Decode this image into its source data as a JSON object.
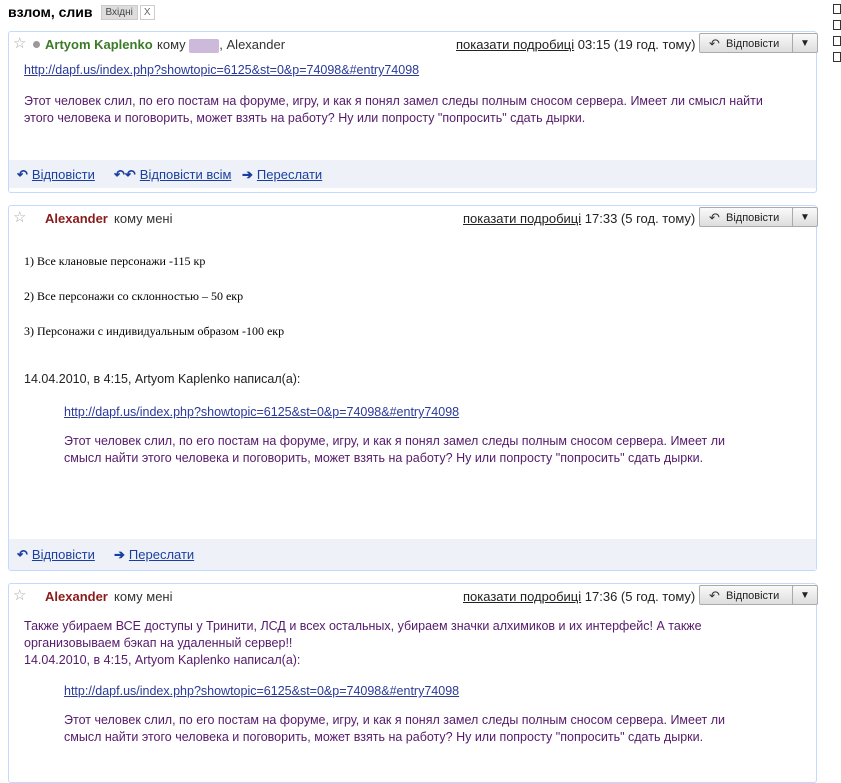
{
  "thread": {
    "subject": "взлом, слив",
    "label": "Вхідні",
    "label_close": "X"
  },
  "msg1": {
    "sender": "Artyom Kaplenko",
    "to_prefix": "кому",
    "to_rest": ", Alexander",
    "show_details": "показати подробиці",
    "time": "03:15 (19 год. тому)",
    "reply": "Відповісти",
    "more": "▼",
    "link": "http://dapf.us/index.php?showtopic=6125&st=0&p=74098&#entry74098",
    "text": "Этот человек слил, по его постам на форуме, игру, и как я понял замел следы полным сносом сервера. Имеет ли смысл найти этого человека и поговорить, может взять на работу? Ну или попросту \"попросить\" сдать дырки.",
    "footer_reply": "Відповісти",
    "footer_reply_all": "Відповісти всім",
    "footer_forward": "Переслати"
  },
  "msg2": {
    "sender": "Alexander",
    "to": "кому мені",
    "show_details": "показати подробиці",
    "time": "17:33 (5 год. тому)",
    "reply": "Відповісти",
    "more": "▼",
    "items": [
      "1)  Все клановые персонажи -115 кр",
      "2)  Все персонажи со склонностью – 50 екр",
      "3)  Персонажи с индивидуальным образом -100 екр"
    ],
    "quote_header": "14.04.2010, в 4:15, Artyom Kaplenko написал(а):",
    "quote_link": "http://dapf.us/index.php?showtopic=6125&st=0&p=74098&#entry74098",
    "quote_line1": "Этот человек слил, по его постам на форуме, игру, и как я понял замел следы полным сносом сервера. Имеет ли",
    "quote_line2": "смысл найти этого человека и поговорить, может взять на работу? Ну или попросту \"попросить\" сдать дырки.",
    "footer_reply": "Відповісти",
    "footer_forward": "Переслати"
  },
  "msg3": {
    "sender": "Alexander",
    "to": "кому мені",
    "show_details": "показати подробиці",
    "time": "17:36 (5 год. тому)",
    "reply": "Відповісти",
    "more": "▼",
    "text_line1": "Также убираем ВСЕ доступы у Тринити, ЛСД и всех остальных, убираем значки алхимиков и их интерфейс! А также",
    "text_line2": "организовываем бэкап на удаленный сервер!!",
    "quote_header": "14.04.2010, в 4:15, Artyom Kaplenko написал(а):",
    "quote_link": "http://dapf.us/index.php?showtopic=6125&st=0&p=74098&#entry74098",
    "quote_line1": "Этот человек слил, по его постам на форуме, игру, и как я понял замел следы полным сносом сервера. Имеет ли",
    "quote_line2": "смысл найти этого человека и поговорить, может взять на работу? Ну или попросту \"попросить\" сдать дырки."
  }
}
